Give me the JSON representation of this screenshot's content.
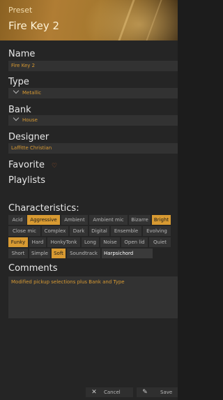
{
  "header": {
    "label": "Preset",
    "name": "Fire Key 2"
  },
  "name": {
    "label": "Name",
    "value": "Fire Key 2"
  },
  "type": {
    "label": "Type",
    "value": "Metallic"
  },
  "bank": {
    "label": "Bank",
    "value": "House"
  },
  "designer": {
    "label": "Designer",
    "value": "Laffitte Christian"
  },
  "favorite": {
    "label": "Favorite",
    "icon": "heart-icon"
  },
  "playlists": {
    "label": "Playlists"
  },
  "characteristics": {
    "label": "Characteristics:",
    "tags": [
      {
        "text": "Acid",
        "selected": false
      },
      {
        "text": "Aggressive",
        "selected": true
      },
      {
        "text": "Ambient",
        "selected": false
      },
      {
        "text": "Ambient mic",
        "selected": false
      },
      {
        "text": "Bizarre",
        "selected": false
      },
      {
        "text": "Bright",
        "selected": true
      },
      {
        "text": "Close mic",
        "selected": false
      },
      {
        "text": "Complex",
        "selected": false
      },
      {
        "text": "Dark",
        "selected": false
      },
      {
        "text": "Digital",
        "selected": false
      },
      {
        "text": "Ensemble",
        "selected": false
      },
      {
        "text": "Evolving",
        "selected": false
      },
      {
        "text": "Funky",
        "selected": true
      },
      {
        "text": "Hard",
        "selected": false
      },
      {
        "text": "HonkyTonk",
        "selected": false
      },
      {
        "text": "Long",
        "selected": false
      },
      {
        "text": "Noise",
        "selected": false
      },
      {
        "text": "Open lid",
        "selected": false
      },
      {
        "text": "Quiet",
        "selected": false
      },
      {
        "text": "Short",
        "selected": false
      },
      {
        "text": "Simple",
        "selected": false
      },
      {
        "text": "Soft",
        "selected": true
      },
      {
        "text": "Soundtrack",
        "selected": false
      }
    ],
    "input_value": "Harpsichord"
  },
  "comments": {
    "label": "Comments",
    "value": "Modified pickup selections plus Bank and Type"
  },
  "footer": {
    "cancel": "Cancel",
    "save": "Save"
  },
  "colors": {
    "accent": "#d89a32",
    "panel": "#252525",
    "field": "#323232"
  }
}
